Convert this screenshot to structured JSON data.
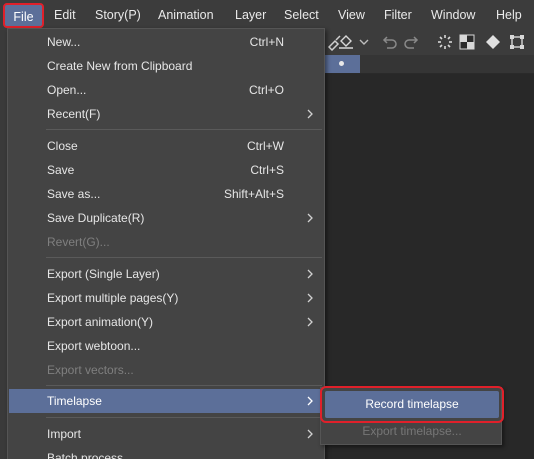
{
  "menubar": {
    "items": [
      "File",
      "Edit",
      "Story(P)",
      "Animation",
      "Layer",
      "Select",
      "View",
      "Filter",
      "Window",
      "Help"
    ]
  },
  "file_menu": {
    "new": {
      "label": "New...",
      "shortcut": "Ctrl+N"
    },
    "create_from_clipboard": {
      "label": "Create New from Clipboard"
    },
    "open": {
      "label": "Open...",
      "shortcut": "Ctrl+O"
    },
    "recent": {
      "label": "Recent(F)"
    },
    "close": {
      "label": "Close",
      "shortcut": "Ctrl+W"
    },
    "save": {
      "label": "Save",
      "shortcut": "Ctrl+S"
    },
    "save_as": {
      "label": "Save as...",
      "shortcut": "Shift+Alt+S"
    },
    "save_duplicate": {
      "label": "Save Duplicate(R)"
    },
    "revert": {
      "label": "Revert(G)..."
    },
    "export_single_layer": {
      "label": "Export (Single Layer)"
    },
    "export_multiple_pages": {
      "label": "Export multiple pages(Y)"
    },
    "export_animation": {
      "label": "Export animation(Y)"
    },
    "export_webtoon": {
      "label": "Export webtoon..."
    },
    "export_vectors": {
      "label": "Export vectors..."
    },
    "timelapse": {
      "label": "Timelapse"
    },
    "import": {
      "label": "Import"
    },
    "batch_process": {
      "label": "Batch process"
    }
  },
  "timelapse_submenu": {
    "record": {
      "label": "Record timelapse"
    },
    "export": {
      "label": "Export timelapse..."
    }
  },
  "colors": {
    "highlight": "#5c6f99",
    "annotation_outline": "#e0202a",
    "menu_bg": "#444444"
  }
}
